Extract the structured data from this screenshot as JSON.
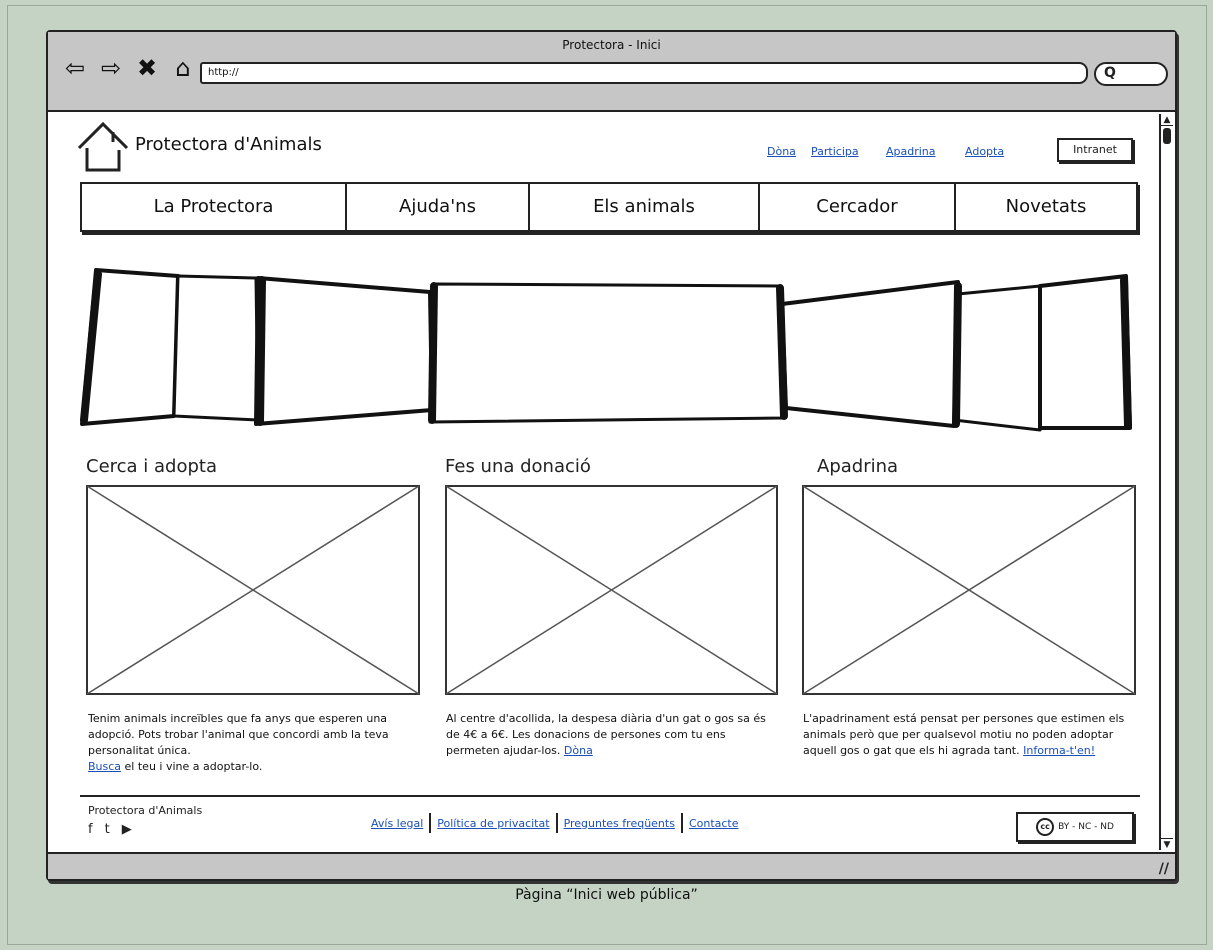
{
  "window": {
    "title": "Protectora - Inici",
    "url": "http://"
  },
  "header": {
    "brand": "Protectora d'Animals",
    "links": [
      "Dòna",
      "Participa",
      "Apadrina",
      "Adopta"
    ],
    "intranet_label": "Intranet"
  },
  "nav": {
    "items": [
      "La Protectora",
      "Ajuda'ns",
      "Els animals",
      "Cercador",
      "Novetats"
    ]
  },
  "sections": [
    {
      "title": "Cerca i adopta",
      "text": "Tenim animals increïbles que fa anys que esperen una adopció. Pots trobar l'animal que concordi amb la teva personalitat única.",
      "link": "Busca",
      "text_after": " el teu i vine a adoptar-lo."
    },
    {
      "title": "Fes una donació",
      "text": "Al centre d'acollida, la despesa diària d'un gat o gos sa és de 4€ a 6€. Les donacions de persones com tu ens permeten ajudar-los. ",
      "link": "Dòna",
      "text_after": ""
    },
    {
      "title": "Apadrina",
      "text": "L'apadrinament está pensat per persones que estimen els animals però que per qualsevol motiu no poden adoptar aquell gos o gat que els hi agrada tant. ",
      "link": "Informa-t'en!",
      "text_after": ""
    }
  ],
  "footer": {
    "brand": "Protectora d'Animals",
    "social_icons": [
      "facebook-icon",
      "twitter-icon",
      "youtube-icon"
    ],
    "links": [
      "Avís legal",
      "Política de privacitat",
      "Preguntes freqüents",
      "Contacte"
    ],
    "license": "BY - NC - ND",
    "license_badge": "cc"
  },
  "caption": "Pàgina “Inici web pública”"
}
